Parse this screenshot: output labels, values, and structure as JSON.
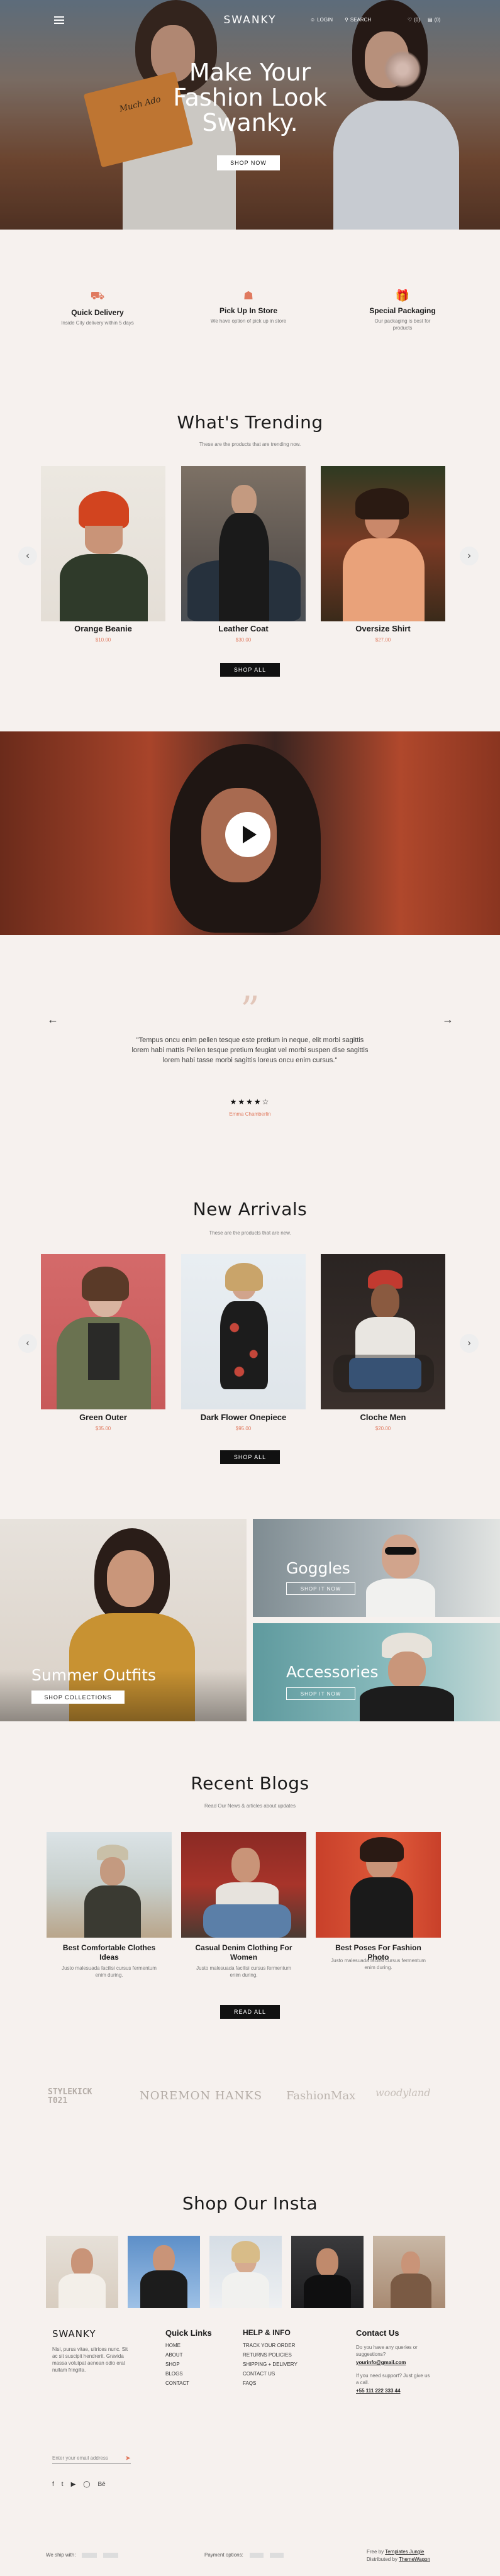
{
  "header": {
    "logo": "SWANKY",
    "login": "LOGIN",
    "search": "SEARCH",
    "wishlist": "(0)",
    "cart": "(0)"
  },
  "hero": {
    "title_line1": "Make Your",
    "title_line2": "Fashion Look",
    "title_line3": "Swanky.",
    "cta": "SHOP NOW",
    "book_text": "Much Ado"
  },
  "features": [
    {
      "title": "Quick Delivery",
      "desc": "Inside City delivery within 5 days",
      "icon": "truck-icon"
    },
    {
      "title": "Pick Up In Store",
      "desc": "We have option of pick up in store",
      "icon": "store-icon"
    },
    {
      "title": "Special Packaging",
      "desc": "Our packaging is best for products",
      "icon": "gift-icon"
    }
  ],
  "trending": {
    "title": "What's Trending",
    "subtitle": "These are the products that are trending now.",
    "products": [
      {
        "name": "Orange Beanie",
        "price": "$10.00"
      },
      {
        "name": "Leather Coat",
        "price": "$30.00"
      },
      {
        "name": "Oversize Shirt",
        "price": "$27.00"
      }
    ],
    "cta": "SHOP ALL"
  },
  "testimonial": {
    "quote": "\"Tempus oncu enim pellen tesque este pretium in neque, elit morbi sagittis lorem habi mattis Pellen tesque pretium feugiat vel morbi suspen dise sagittis lorem habi tasse morbi sagittis loreus oncu enim cursus.\"",
    "stars": "★★★★☆",
    "author": "Emma Chamberlin",
    "prev": "←",
    "next": "→"
  },
  "new_arrivals": {
    "title": "New Arrivals",
    "subtitle": "These are the products that are new.",
    "products": [
      {
        "name": "Green Outer",
        "price": "$35.00"
      },
      {
        "name": "Dark Flower Onepiece",
        "price": "$95.00"
      },
      {
        "name": "Cloche Men",
        "price": "$20.00"
      }
    ],
    "cta": "SHOP ALL"
  },
  "collections": {
    "summer": {
      "title": "Summer Outfits",
      "cta": "SHOP COLLECTIONS"
    },
    "goggles": {
      "title": "Goggles",
      "cta": "SHOP IT NOW"
    },
    "accessories": {
      "title": "Accessories",
      "cta": "SHOP IT NOW"
    }
  },
  "blogs": {
    "title": "Recent Blogs",
    "subtitle": "Read Our News & articles about updates",
    "posts": [
      {
        "title": "Best Comfortable Clothes Ideas",
        "excerpt": "Justo malesuada facilisi cursus fermentum enim during."
      },
      {
        "title": "Casual Denim Clothing For Women",
        "excerpt": "Justo malesuada facilisi cursus fermentum enim during."
      },
      {
        "title": "Best Poses For Fashion Photo",
        "excerpt": "Justo malesuada facilisi cursus fermentum enim during."
      }
    ],
    "cta": "READ ALL"
  },
  "brands": [
    "STYLEKICK T021",
    "NOREMON HANKS",
    "FashionMax",
    "woodyland"
  ],
  "insta": {
    "title": "Shop Our Insta"
  },
  "footer": {
    "logo": "SWANKY",
    "about": "Nisi, purus vitae, ultrices nunc. Sit ac sit suscipit hendrerit. Gravida massa volutpat aenean odio erat nullam fringilla.",
    "email_placeholder": "Enter your email address",
    "quick_links_title": "Quick Links",
    "quick_links": [
      "HOME",
      "ABOUT",
      "SHOP",
      "BLOGS",
      "CONTACT"
    ],
    "help_title": "Help & Info",
    "help_links": [
      "TRACK YOUR ORDER",
      "RETURNS POLICIES",
      "SHIPPING + DELIVERY",
      "CONTACT US",
      "FAQS"
    ],
    "contact_title": "Contact Us",
    "contact_q": "Do you have any queries or suggestions?",
    "contact_email": "yourinfo@gmail.com",
    "contact_support": "If you need support? Just give us a call.",
    "contact_phone": "+55 111 222 333 44",
    "ship_with": "We ship with:",
    "payment": "Payment options:",
    "credit1": "Free by",
    "credit1_link": "Templates Jungle",
    "credit2": "Distributed by",
    "credit2_link": "ThemeWagon"
  }
}
